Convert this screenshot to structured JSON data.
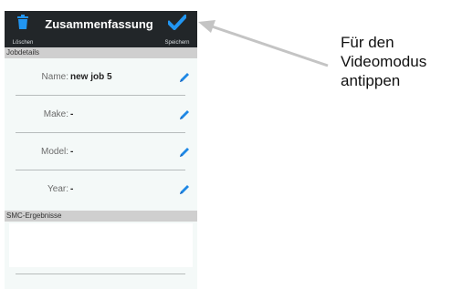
{
  "header": {
    "title": "Zusammenfassung",
    "delete_label": "Löschen",
    "save_label": "Speichern"
  },
  "job_section": {
    "title": "Jobdetails",
    "rows": [
      {
        "label": "Name:",
        "value": "new job 5"
      },
      {
        "label": "Make:",
        "value": "-"
      },
      {
        "label": "Model:",
        "value": "-"
      },
      {
        "label": "Year:",
        "value": "-"
      }
    ]
  },
  "smc_section": {
    "title": "SMC-Ergebnisse"
  },
  "annotation": {
    "text": "Für den\nVideomodus\nantippen"
  },
  "icons": {
    "delete": "trash-icon",
    "save": "checkmark-icon",
    "edit": "pencil-icon"
  },
  "colors": {
    "topbar": "#222629",
    "accent": "#1e88e5",
    "section_header": "#cfcfcf",
    "background": "#f4f9f8"
  }
}
